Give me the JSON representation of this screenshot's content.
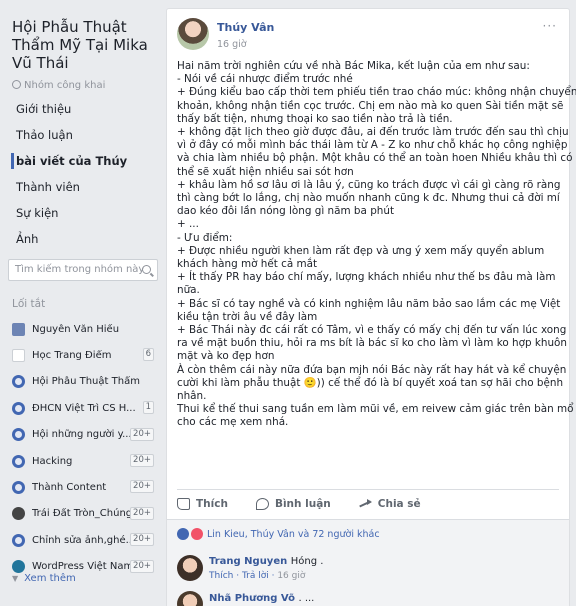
{
  "group": {
    "title": "Hội Phẫu Thuật Thẩm Mỹ Tại Mika Vũ Thái",
    "type": "Nhóm công khai"
  },
  "nav": [
    {
      "label": "Giới thiệu",
      "active": false
    },
    {
      "label": "Thảo luận",
      "active": false
    },
    {
      "label": "bài viết của Thúy",
      "active": true
    },
    {
      "label": "Thành viên",
      "active": false
    },
    {
      "label": "Sự kiện",
      "active": false
    },
    {
      "label": "Ảnh",
      "active": false
    }
  ],
  "search": {
    "placeholder": "Tìm kiếm trong nhóm này"
  },
  "shortcuts": {
    "heading": "Lối tắt",
    "items": [
      {
        "label": "Nguyễn Văn Hiếu",
        "icon": "shield-icon",
        "badge": ""
      },
      {
        "label": "Học Trang Điểm",
        "icon": "page-icon",
        "badge": "6"
      },
      {
        "label": "Hội Phẫu Thuật Thẩm ...",
        "icon": "group-icon",
        "badge": ""
      },
      {
        "label": "ĐHCN Việt Trì CS H...",
        "icon": "group-icon",
        "badge": "1"
      },
      {
        "label": "Hội những người y...",
        "icon": "group-icon",
        "badge": "20+"
      },
      {
        "label": "Hacking",
        "icon": "group-icon",
        "badge": "20+"
      },
      {
        "label": "Thành Content",
        "icon": "group-icon",
        "badge": "20+"
      },
      {
        "label": "Trái Đất Tròn_Chúng...",
        "icon": "skull-icon",
        "badge": "20+"
      },
      {
        "label": "Chỉnh sửa ảnh,ghé...",
        "icon": "group-icon",
        "badge": "20+"
      },
      {
        "label": "WordPress Việt Nam",
        "icon": "wordpress-icon",
        "badge": "20+"
      }
    ],
    "see_more": "Xem thêm"
  },
  "post": {
    "author": "Thúy Vân",
    "time": "16 giờ",
    "lines": [
      "Hai năm trời nghiên cứu về nhà Bác Mika, kết luận của em như sau:",
      "- Nói về cái nhược điểm trước nhé",
      "+ Đúng kiểu bao cấp thời tem phiếu tiền trao cháo múc: không nhận chuyển",
      "khoản, không nhận tiền cọc trước. Chị em nào mà ko quen Sài tiền mặt sẽ",
      "thấy bất tiện, nhưng thoại ko sao tiền nào trả là tiền.",
      "+ không đặt lịch theo giờ được đâu, ai đến trước làm trước đến sau thì chịu",
      "vì ở đây có mỗi mình bác thái làm từ A - Z ko như chỗ khác họ công nghiệp",
      "và chia làm nhiều bộ phận. Một khâu có thể an toàn hoen Nhiều khâu thì có",
      "thể sẽ xuất hiện nhiều sai sót hơn",
      "+ khâu làm hồ sơ lâu ơi là lâu ý, cũng ko trách được vì cái gì càng rõ ràng",
      "thì càng bớt lo lắng, chị nào muốn nhanh cũng k đc. Nhưng thui cả đời mí",
      "dao kéo đôi lần nóng lòng gì năm ba phút",
      "+ ...",
      "- Ưu điểm:",
      "+ Được nhiều người khen làm rất đẹp và ưng ý xem mấy quyển ablum",
      "khách hàng mờ hết cả mắt",
      "+ Ít thấy PR hay báo chí mấy, lượng khách nhiều như thế bs đâu mà làm",
      "nữa.",
      "+ Bác sĩ có tay nghề và có kinh nghiệm lâu năm bảo sao lắm các mẹ Việt",
      "kiều tận trời âu về đây làm",
      "+ Bác Thái này đc cái rất có Tâm, vì e thấy có mấy chị đến tư vấn lúc xong",
      "ra về mặt buồn thiu, hỏi ra ms bít là bác sĩ ko cho làm vì làm ko hợp khuôn",
      "mặt và ko đẹp hơn",
      "À còn thêm cái này nữa đứa bạn mjh nói Bác này rất hay hát và kể chuyện",
      "cười khi làm phẫu thuật 🙂)) cế thể đó là bí quyết xoá tan sợ hãi cho bệnh",
      "nhân.",
      "Thui kể thế thui sang tuần em làm mũi về, em reivew cảm giác trên bàn mổ",
      "cho các mẹ xem nhá."
    ],
    "actions": {
      "like": "Thích",
      "comment": "Bình luận",
      "share": "Chia sẻ"
    },
    "reactions_text": "Lin Kieu, Thúy Vân và 72 người khác"
  },
  "comments": [
    {
      "name": "Trang Nguyen",
      "text": "Hóng .",
      "like": "Thích",
      "reply": "Trả lời",
      "time": "16 giờ"
    },
    {
      "name": "Nhã Phương Võ",
      "text": ". ..."
    }
  ]
}
